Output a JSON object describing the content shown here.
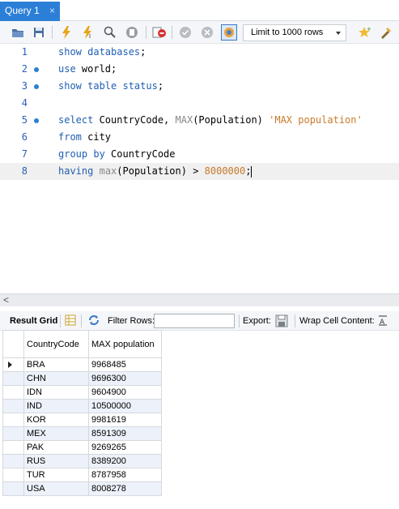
{
  "tabs": [
    {
      "label": "Query 1",
      "close": "×"
    }
  ],
  "toolbar": {
    "limit_label": "Limit to 1000 rows",
    "icons": [
      "folder-open-icon",
      "save-icon",
      "execute-icon",
      "execute-current-icon",
      "explain-icon",
      "stop-icon",
      "toggle-continue-icon",
      "commit-icon",
      "rollback-icon",
      "autocommit-icon",
      "bookmark-icon",
      "beautify-icon"
    ]
  },
  "editor": {
    "lines": [
      {
        "n": "1",
        "dot": false,
        "tokens": [
          {
            "t": "show databases",
            "c": "kw"
          },
          {
            "t": ";",
            "c": ""
          }
        ]
      },
      {
        "n": "2",
        "dot": true,
        "tokens": [
          {
            "t": "use",
            "c": "kw"
          },
          {
            "t": " world;",
            "c": ""
          }
        ]
      },
      {
        "n": "3",
        "dot": true,
        "tokens": [
          {
            "t": "show table status",
            "c": "kw"
          },
          {
            "t": ";",
            "c": ""
          }
        ]
      },
      {
        "n": "4",
        "dot": false,
        "tokens": []
      },
      {
        "n": "5",
        "dot": true,
        "tokens": [
          {
            "t": "select",
            "c": "kw"
          },
          {
            "t": " CountryCode, ",
            "c": ""
          },
          {
            "t": "MAX",
            "c": "fn"
          },
          {
            "t": "(Population) ",
            "c": ""
          },
          {
            "t": "'MAX population'",
            "c": "str"
          }
        ]
      },
      {
        "n": "6",
        "dot": false,
        "tokens": [
          {
            "t": "from",
            "c": "kw"
          },
          {
            "t": " city",
            "c": ""
          }
        ]
      },
      {
        "n": "7",
        "dot": false,
        "tokens": [
          {
            "t": "group by",
            "c": "kw"
          },
          {
            "t": " CountryCode",
            "c": ""
          }
        ]
      },
      {
        "n": "8",
        "dot": false,
        "tokens": [
          {
            "t": "having",
            "c": "kw"
          },
          {
            "t": " ",
            "c": ""
          },
          {
            "t": "max",
            "c": "fn"
          },
          {
            "t": "(Population) > ",
            "c": ""
          },
          {
            "t": "8000000",
            "c": "num"
          },
          {
            "t": ";",
            "c": ""
          }
        ]
      }
    ]
  },
  "result_toolbar": {
    "result_grid_label": "Result Grid",
    "filter_rows_label": "Filter Rows:",
    "filter_value": "",
    "export_label": "Export:",
    "wrap_label": "Wrap Cell Content:"
  },
  "grid": {
    "columns": [
      "CountryCode",
      "MAX population"
    ],
    "rows": [
      [
        "BRA",
        "9968485"
      ],
      [
        "CHN",
        "9696300"
      ],
      [
        "IDN",
        "9604900"
      ],
      [
        "IND",
        "10500000"
      ],
      [
        "KOR",
        "9981619"
      ],
      [
        "MEX",
        "8591309"
      ],
      [
        "PAK",
        "9269265"
      ],
      [
        "RUS",
        "8389200"
      ],
      [
        "TUR",
        "8787958"
      ],
      [
        "USA",
        "8008278"
      ]
    ]
  },
  "colors": {
    "accent": "#2c7fd6",
    "keyword": "#1f5fb3",
    "string": "#c97a2a"
  }
}
